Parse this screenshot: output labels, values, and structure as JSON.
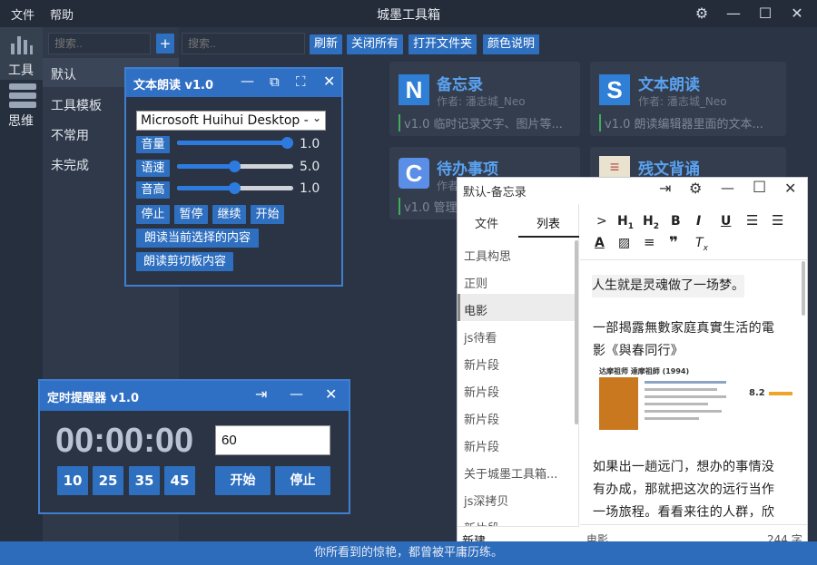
{
  "menu": {
    "file": "文件",
    "help": "帮助"
  },
  "app_title": "城墨工具箱",
  "rail": {
    "tools_label": "工具",
    "mind_label": "思维"
  },
  "sidebar": {
    "search_placeholder": "搜索..",
    "add_label": "+",
    "categories": [
      "默认",
      "工具模板",
      "不常用",
      "未完成"
    ]
  },
  "toolbar": {
    "search_placeholder": "搜索..",
    "refresh": "刷新",
    "close_all": "关闭所有",
    "open_folder": "打开文件夹",
    "color_help": "颜色说明"
  },
  "cards": [
    {
      "logo": "N",
      "title": "备忘录",
      "author": "作者: 潘志城_Neo",
      "desc": "v1.0 临时记录文字、图片等...",
      "color": "#2f7fd6"
    },
    {
      "logo": "S",
      "title": "文本朗读",
      "author": "作者: 潘志城_Neo",
      "desc": "v1.0 朗读编辑器里面的文本...",
      "color": "#2f7fd6"
    },
    {
      "logo": "C",
      "title": "待办事项",
      "author": "作者",
      "desc": "v1.0 管理",
      "color": "#5b8ee6"
    },
    {
      "logo": "≡",
      "title": "残文背诵",
      "author": "",
      "desc": "",
      "color": "#e9e2cf"
    }
  ],
  "tts": {
    "title": "文本朗读 v1.0",
    "voice": "Microsoft Huihui Desktop -",
    "volume_label": "音量",
    "volume_value": "1.0",
    "volume_fraction": 1.0,
    "speed_label": "语速",
    "speed_value": "5.0",
    "speed_fraction": 0.5,
    "pitch_label": "音高",
    "pitch_value": "1.0",
    "pitch_fraction": 0.5,
    "stop": "停止",
    "pause": "暂停",
    "resume": "继续",
    "start": "开始",
    "read_selection": "朗读当前选择的内容",
    "read_clipboard": "朗读剪切板内容"
  },
  "timer": {
    "title": "定时提醒器 v1.0",
    "display": "00:00:00",
    "input_value": "60",
    "presets": [
      "10",
      "25",
      "35",
      "45"
    ],
    "start": "开始",
    "stop": "停止"
  },
  "memo": {
    "title": "默认-备忘录",
    "tab_file": "文件",
    "tab_list": "列表",
    "list": [
      "工具构思",
      "正则",
      "电影",
      "js待看",
      "新片段",
      "新片段",
      "新片段",
      "新片段",
      "关于城墨工具箱...",
      "js深拷贝",
      "新片段"
    ],
    "new_label": "新建",
    "line1": "人生就是灵魂做了一场梦。",
    "para1a": "一部揭露無數家庭真實生活的電",
    "para1b": "影《與春同行》",
    "movie_caption": "达摩祖师 達摩祖師 (1994)",
    "movie_score": "8.2",
    "para2a": "如果出一趟远门，想办的事情没",
    "para2b": "有办成，那就把这次的远行当作",
    "para2c": "一场旅程。看看来往的人群，欣",
    "status_name": "电影",
    "status_count": "244 字",
    "format_icons": [
      ">",
      "H1",
      "H2",
      "B",
      "I",
      "U",
      "ol",
      "ul",
      "A",
      "hl",
      "align",
      "quote",
      "Tx"
    ]
  },
  "status_text": "你所看到的惊艳，都曾被平庸历练。"
}
